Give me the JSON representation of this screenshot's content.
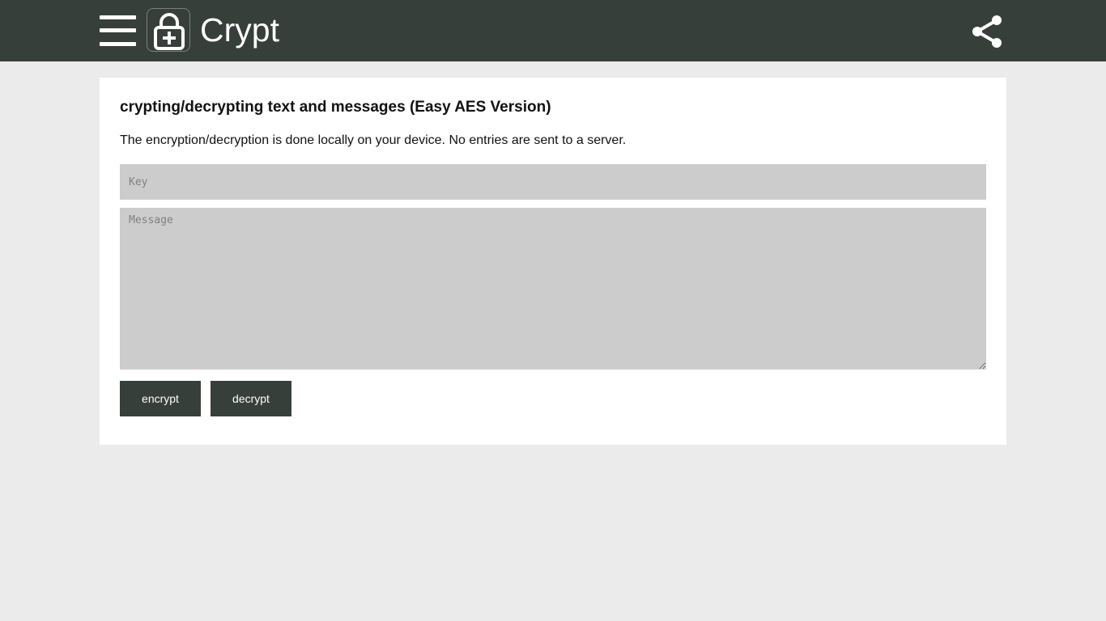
{
  "header": {
    "app_title": "Crypt",
    "menu_icon": "hamburger-menu-icon",
    "logo_icon": "padlock-plus-icon",
    "share_icon": "share-icon",
    "background_color": "#373f3b"
  },
  "main": {
    "heading": "crypting/decrypting text and messages (Easy AES Version)",
    "description": "The encryption/decryption is done locally on your device. No entries are sent to a server.",
    "key_field": {
      "value": "",
      "placeholder": "Key"
    },
    "message_field": {
      "value": "",
      "placeholder": "Message"
    },
    "buttons": {
      "encrypt_label": "encrypt",
      "decrypt_label": "decrypt"
    }
  },
  "colors": {
    "page_background": "#ebebeb",
    "card_background": "#ffffff",
    "input_background": "#cccccc",
    "button_background": "#373f3b"
  }
}
